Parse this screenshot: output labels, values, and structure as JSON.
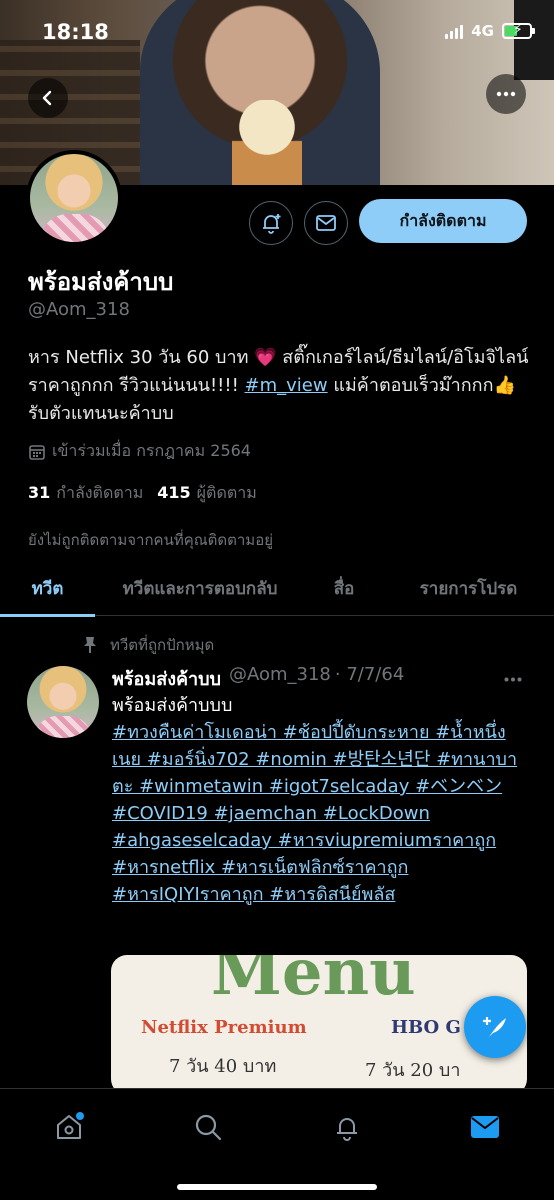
{
  "status_bar": {
    "time": "18:18",
    "network": "4G",
    "battery_charging": true
  },
  "profile": {
    "display_name": "พร้อมส่งค้าบบ",
    "handle": "@Aom_318",
    "bio_text": "หาร Netflix 30 วัน 60 บาท 💗  สติ๊กเกอร์ไลน์/ธีมไลน์/อิโมจิไลน์ ราคาถูกกก รีวิวแน่นนน!!!! ",
    "bio_link": "#m_view",
    "bio_text_after": " แม่ค้าตอบเร็วม๊ากกก👍  รับตัวแทนนะค้าบบ",
    "joined": "เข้าร่วมเมื่อ กรกฎาคม 2564",
    "following_count": "31",
    "following_label": "กำลังติดตาม",
    "followers_count": "415",
    "followers_label": "ผู้ติดตาม",
    "not_followed_text": "ยังไม่ถูกติดตามจากคนที่คุณติดตามอยู่",
    "follow_button_label": "กำลังติดตาม"
  },
  "tabs": [
    {
      "label": "ทวีต",
      "active": true
    },
    {
      "label": "ทวีตและการตอบกลับ",
      "active": false
    },
    {
      "label": "สื่อ",
      "active": false
    },
    {
      "label": "รายการโปรด",
      "active": false
    }
  ],
  "tweet": {
    "pinned_label": "ทวีตที่ถูกปักหมุด",
    "author_name": "พร้อมส่งค้าบบ",
    "author_handle": "@Aom_318",
    "date": "· 7/7/64",
    "text": "พร้อมส่งค้าบบบ",
    "hashtags": "#ทวงคืนค่าโมเดอน่า #ช้อปปี้ดับกระหาย #น้ำหนึ่งเนย #มอร์นิ่ง702 #nomin #방탄소년단 #ทานาบาตะ #winmetawin #igot7selcaday #ベンベン #COVID19 #jaemchan #LockDown #ahgaseselcaday #หารviupremiumราคาถูก #หารnetflix #หารเน็ตฟลิกซ์ราคาถูก #หารIQIYIราคาถูก #หารดิสนีย์พลัส",
    "media": {
      "title": "Menu",
      "netflix_label": "Netflix Premium",
      "netflix_price": "7 วัน 40 บาท",
      "hbo_label": "HBO G",
      "hbo_price": "7 วัน 20 บา"
    }
  },
  "icons": {
    "back": "back-arrow-icon",
    "more": "more-icon",
    "notify": "bell-plus-icon",
    "message": "mail-icon",
    "calendar": "calendar-icon",
    "pin": "pin-icon",
    "compose": "compose-tweet-icon",
    "home": "home-icon",
    "search": "search-icon",
    "notifications": "bell-icon",
    "messages": "mail-icon"
  },
  "colors": {
    "accent": "#8ecdf8",
    "background": "#000000",
    "muted": "#71767b"
  }
}
